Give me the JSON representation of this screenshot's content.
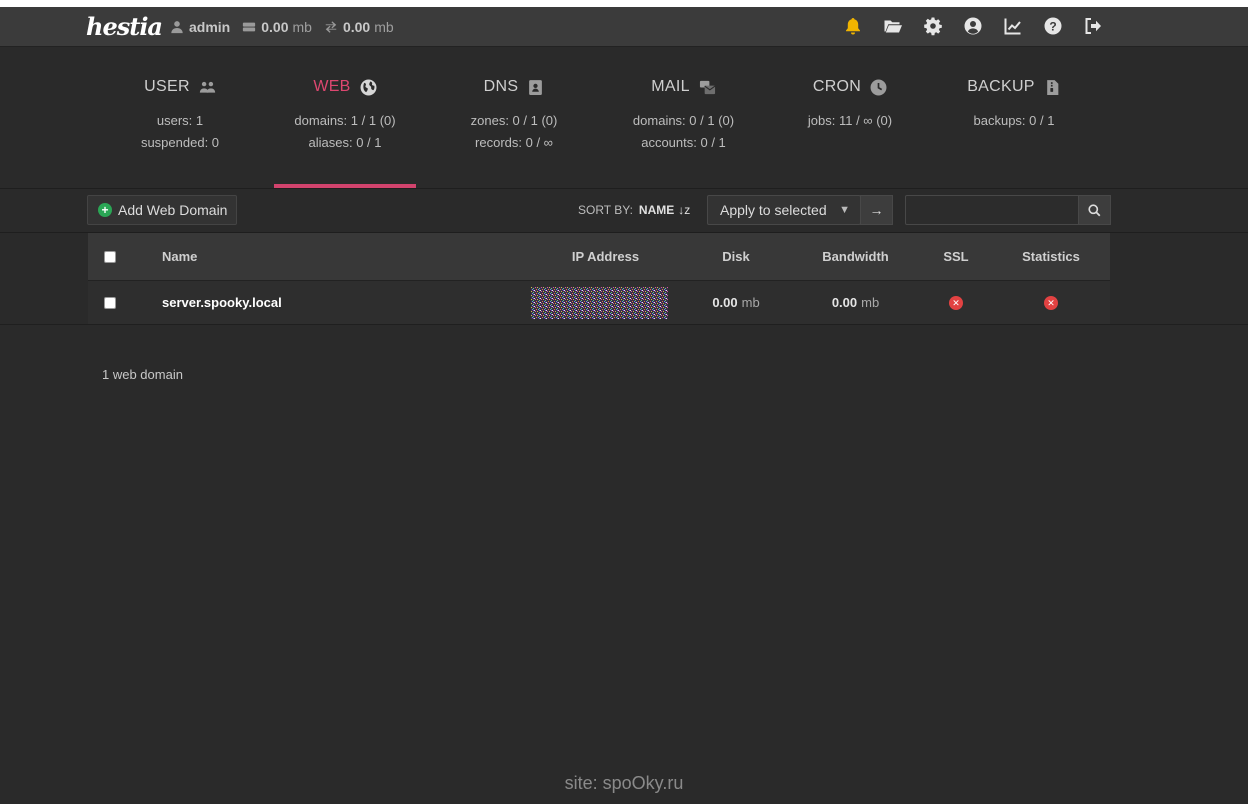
{
  "app": {
    "logo_text": "hestia"
  },
  "topbar": {
    "user": "admin",
    "disk_value": "0.00",
    "disk_unit": "mb",
    "bandwidth_value": "0.00",
    "bandwidth_unit": "mb",
    "icons": [
      "bell-icon",
      "folder-icon",
      "gear-icon",
      "user-circle-icon",
      "chart-line-icon",
      "help-icon",
      "logout-icon"
    ],
    "accent_bell": "#f0b400"
  },
  "stats": [
    {
      "title": "USER",
      "icon": "users-icon",
      "line1": "users: 1",
      "line2": "suspended: 0"
    },
    {
      "title": "WEB",
      "icon": "globe-icon",
      "line1": "domains: 1 / 1 (0)",
      "line2": "aliases: 0 / 1",
      "active": true
    },
    {
      "title": "DNS",
      "icon": "address-book-icon",
      "line1": "zones: 0 / 1 (0)",
      "line2": "records: 0 / ∞"
    },
    {
      "title": "MAIL",
      "icon": "mail-bulk-icon",
      "line1": "domains: 0 / 1 (0)",
      "line2": "accounts: 0 / 1"
    },
    {
      "title": "CRON",
      "icon": "clock-icon",
      "line1": "jobs: 11 / ∞ (0)",
      "line2": ""
    },
    {
      "title": "BACKUP",
      "icon": "file-archive-icon",
      "line1": "backups: 0 / 1",
      "line2": ""
    }
  ],
  "colors": {
    "active_tab": "#d2436d",
    "add_button_plus": "#2aa655",
    "status_error": "#e24242"
  },
  "toolbar": {
    "add_label": "Add Web Domain",
    "sort_label": "SORT BY:",
    "sort_value": "NAME",
    "apply_label": "Apply to selected",
    "go_label": "→",
    "search_value": "",
    "search_placeholder": ""
  },
  "table": {
    "headers": [
      "Name",
      "IP Address",
      "Disk",
      "Bandwidth",
      "SSL",
      "Statistics"
    ],
    "rows": [
      {
        "name": "server.spooky.local",
        "ip": "",
        "disk_value": "0.00",
        "disk_unit": "mb",
        "bandwidth_value": "0.00",
        "bandwidth_unit": "mb",
        "ssl": "disabled",
        "statistics": "disabled"
      }
    ]
  },
  "footer": {
    "count": "1 web domain",
    "watermark": "site: spoOky.ru"
  }
}
